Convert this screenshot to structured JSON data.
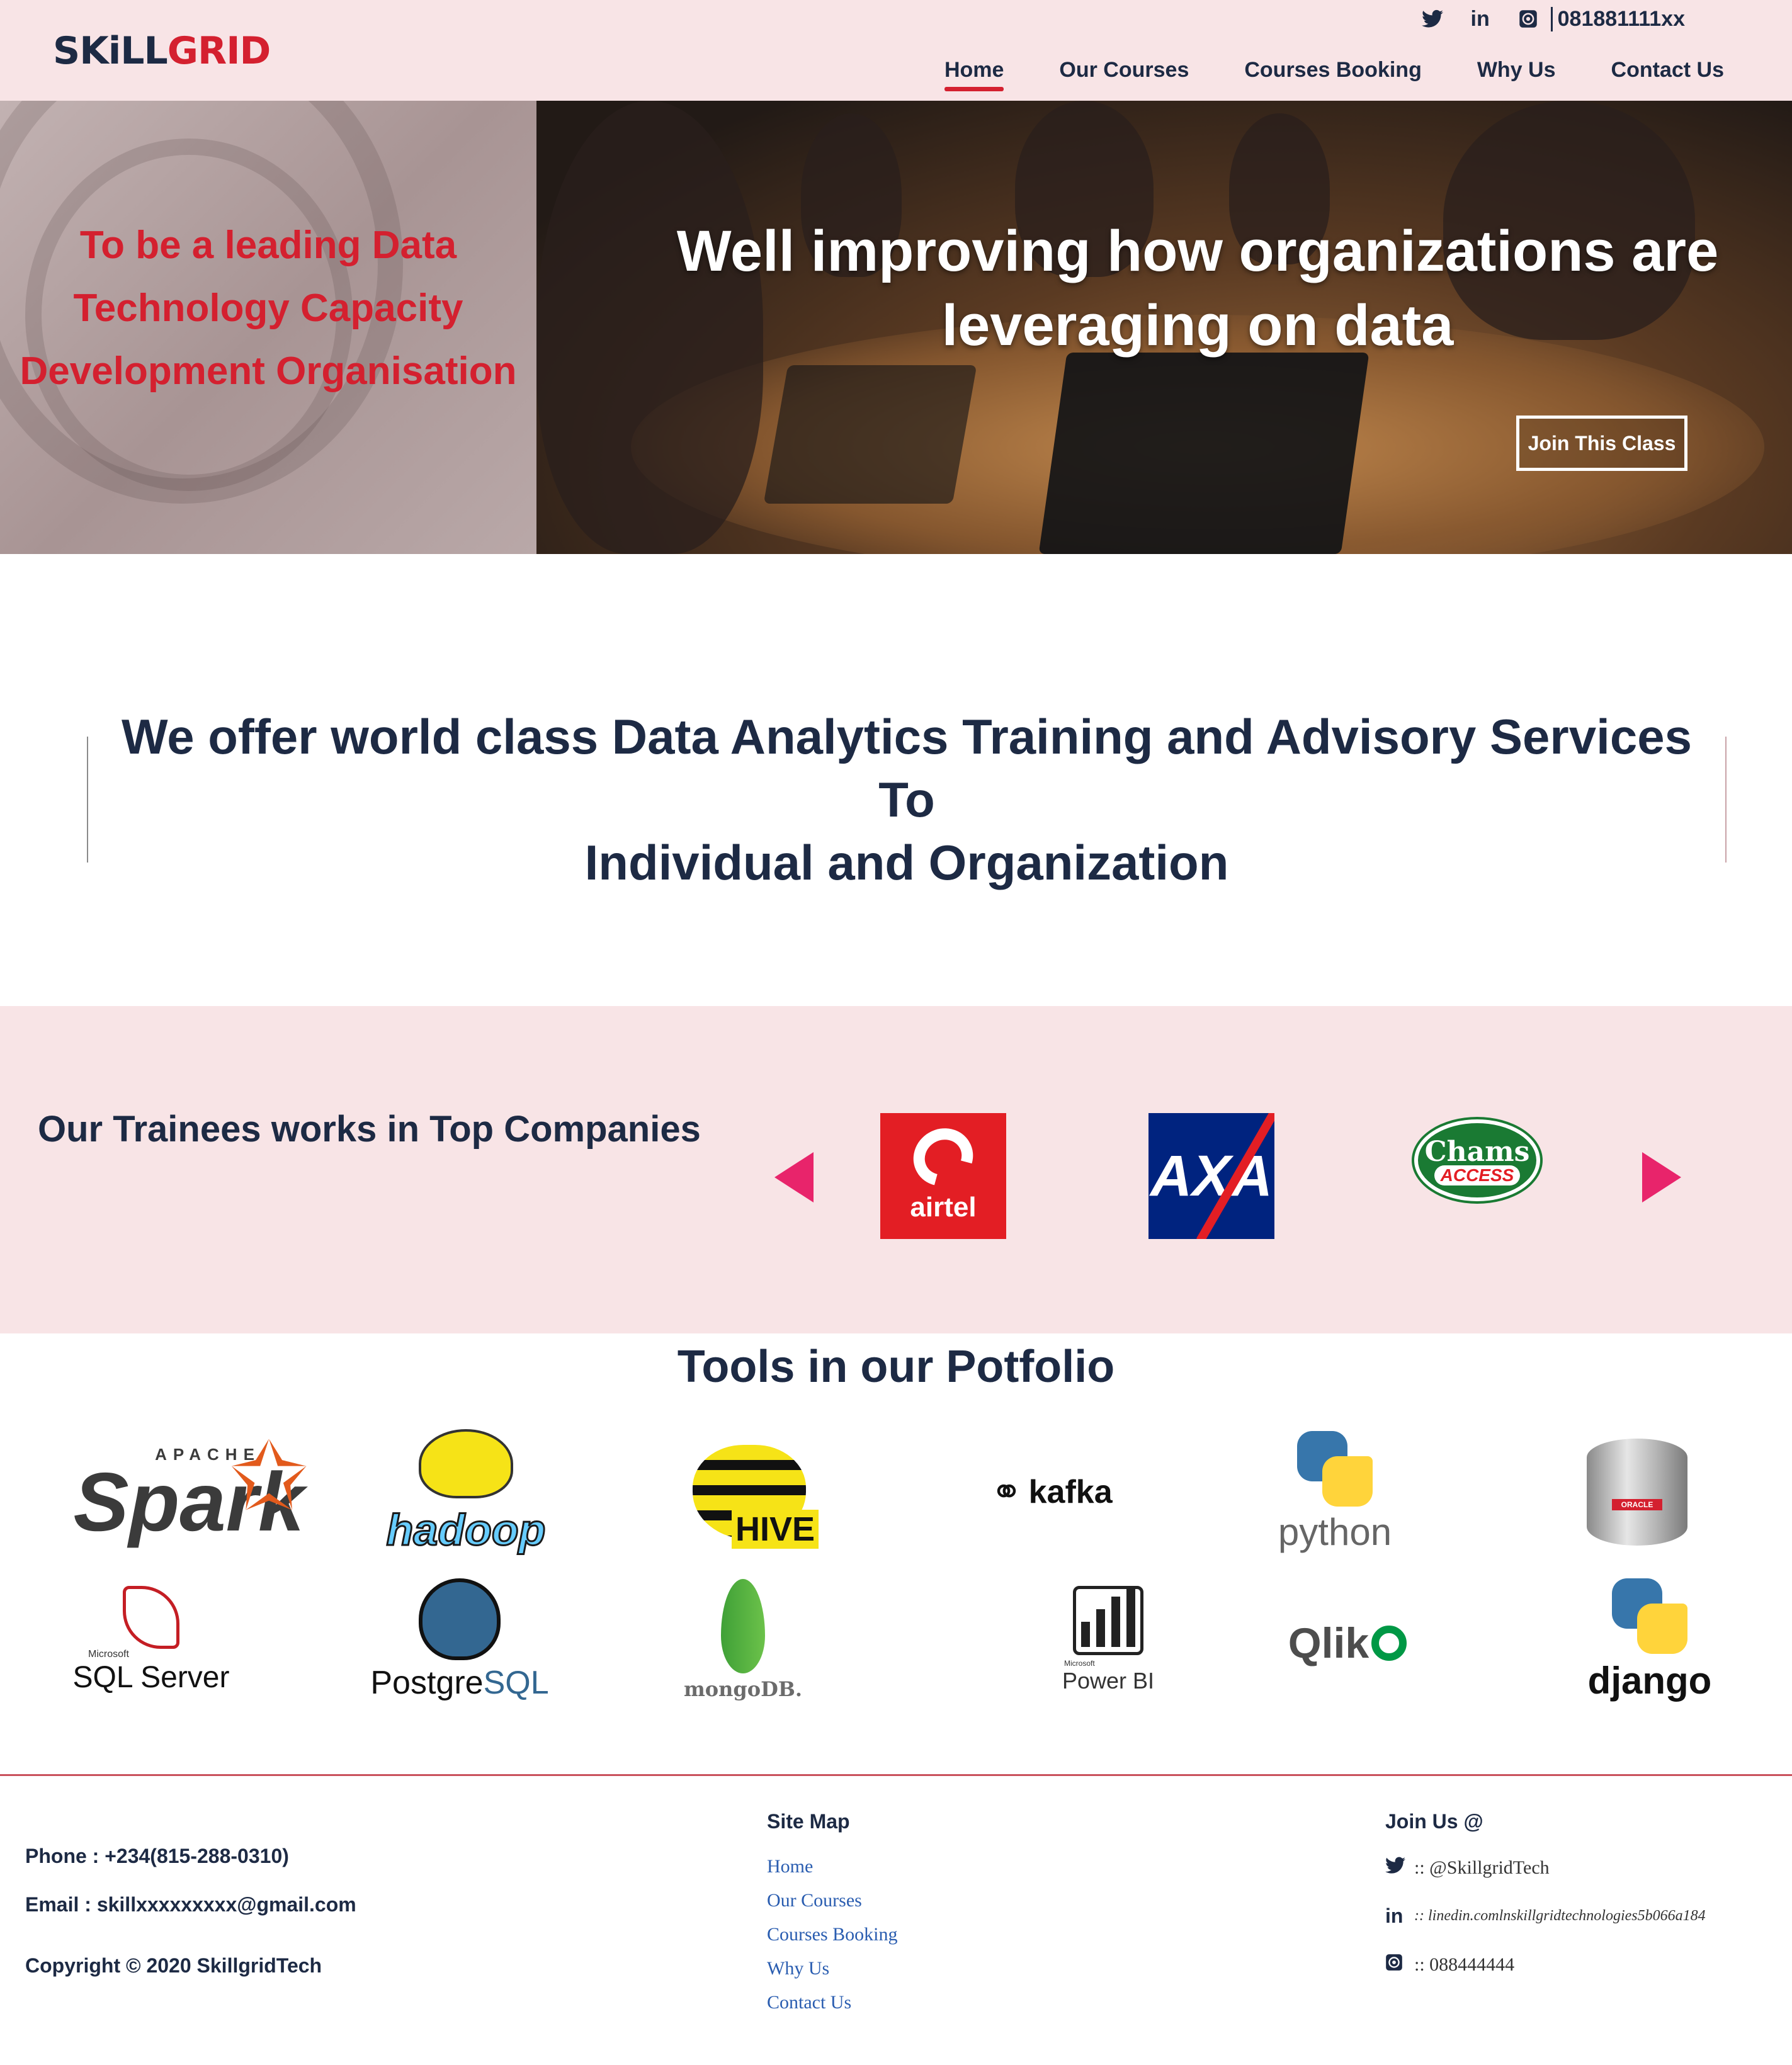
{
  "header": {
    "logo_part1": "SKiLL",
    "logo_part2": "GRID",
    "phone": "081881111xx",
    "icons": [
      "twitter-icon",
      "linkedin-icon",
      "whatsapp-icon"
    ],
    "nav": [
      {
        "label": "Home",
        "active": true
      },
      {
        "label": "Our Courses"
      },
      {
        "label": "Courses Booking"
      },
      {
        "label": "Why Us"
      },
      {
        "label": "Contact Us"
      }
    ]
  },
  "hero": {
    "mission_line1": "To be a leading Data",
    "mission_line2": "Technology Capacity",
    "mission_line3": "Development Organisation",
    "headline_line1": "Well improving how organizations are",
    "headline_line2": "leveraging on data",
    "cta": "Join This Class"
  },
  "offer": {
    "line1": "We offer world class Data Analytics Training and Advisory Services To",
    "line2": "Individual and Organization"
  },
  "trainees": {
    "title": "Our Trainees works in Top Companies",
    "companies": [
      {
        "name": "airtel"
      },
      {
        "name": "AXA"
      },
      {
        "name": "Chams",
        "sub": "ACCESS"
      }
    ]
  },
  "tools": {
    "title": "Tools in our Potfolio",
    "items": {
      "spark_small": "APACHE",
      "spark": "Spark",
      "hadoop": "hadoop",
      "hive": "HIVE",
      "kafka": "kafka",
      "python": "python",
      "oracle_tag": "ORACLE",
      "sqlserver_ms": "Microsoft",
      "sqlserver": "SQL Server",
      "postgres_a": "Postgre",
      "postgres_b": "SQL",
      "mongo": "mongoDB.",
      "powerbi_ms": "Microsoft",
      "powerbi": "Power BI",
      "qlik": "Qlik",
      "django": "django"
    }
  },
  "footer": {
    "phone": "Phone : +234(815-288-0310)",
    "email": "Email : skillxxxxxxxxx@gmail.com",
    "copyright": "Copyright © 2020 SkillgridTech",
    "sitemap_title": "Site Map",
    "sitemap": [
      "Home",
      "Our Courses",
      "Courses Booking",
      "Why Us",
      "Contact Us"
    ],
    "join_title": "Join Us @",
    "twitter": ":: @SkillgridTech",
    "linkedin": ":: linedin.comlnskillgridtechnologies5b066a184",
    "whatsapp": ":: 088444444"
  }
}
